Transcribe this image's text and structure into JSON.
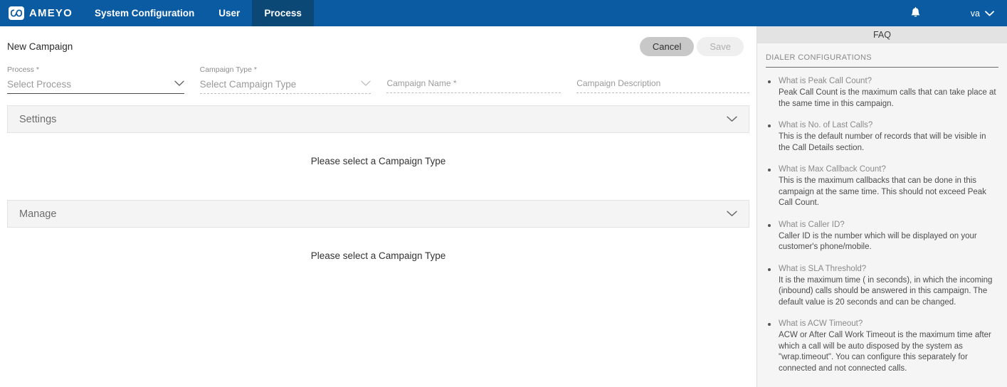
{
  "navbar": {
    "brand": "AMEYO",
    "items": [
      {
        "label": "System Configuration",
        "active": false
      },
      {
        "label": "User",
        "active": false
      },
      {
        "label": "Process",
        "active": true
      }
    ],
    "notification_icon": "bell-icon",
    "user": "va",
    "user_caret_icon": "chevron-down-icon",
    "background_color": "#0a5ba1",
    "active_tab_color": "#0c4876"
  },
  "form": {
    "title": "New Campaign",
    "cancel_label": "Cancel",
    "save_label": "Save",
    "fields": {
      "process": {
        "label": "Process *",
        "value": "Select Process"
      },
      "campaign_type": {
        "label": "Campaign Type *",
        "value": "Select Campaign Type"
      },
      "campaign_name": {
        "label": "",
        "placeholder": "Campaign Name *"
      },
      "campaign_description": {
        "label": "",
        "placeholder": "Campaign Description"
      }
    }
  },
  "panels": [
    {
      "title": "Settings",
      "chevron_icon": "chevron-down-icon",
      "empty_text": "Please select a Campaign Type"
    },
    {
      "title": "Manage",
      "chevron_icon": "chevron-down-icon",
      "empty_text": "Please select a Campaign Type"
    }
  ],
  "faq": {
    "header": "FAQ",
    "section_title": "DIALER CONFIGURATIONS",
    "items": [
      {
        "question": "What is Peak Call Count?",
        "answer": "Peak Call Count is the maximum calls that can take place at the same time in this campaign."
      },
      {
        "question": "What is No. of Last Calls?",
        "answer": "This is the default number of records that will be visible in the Call Details section."
      },
      {
        "question": "What is Max Callback Count?",
        "answer": "This is the maximum callbacks that can be done in this campaign at the same time. This should not exceed Peak Call Count."
      },
      {
        "question": "What is Caller ID?",
        "answer": "Caller ID is the number which will be displayed on your customer's phone/mobile."
      },
      {
        "question": "What is SLA Threshold?",
        "answer": "It is the maximum time ( in seconds), in which the incoming (inbound) calls should be answered in this campaign. The default value is 20 seconds and can be changed."
      },
      {
        "question": "What is ACW Timeout?",
        "answer": "ACW or After Call Work Timeout is the maximum time after which a call will be auto disposed by the system as \"wrap.timeout\". You can configure this separately for connected and not connected calls."
      }
    ]
  }
}
